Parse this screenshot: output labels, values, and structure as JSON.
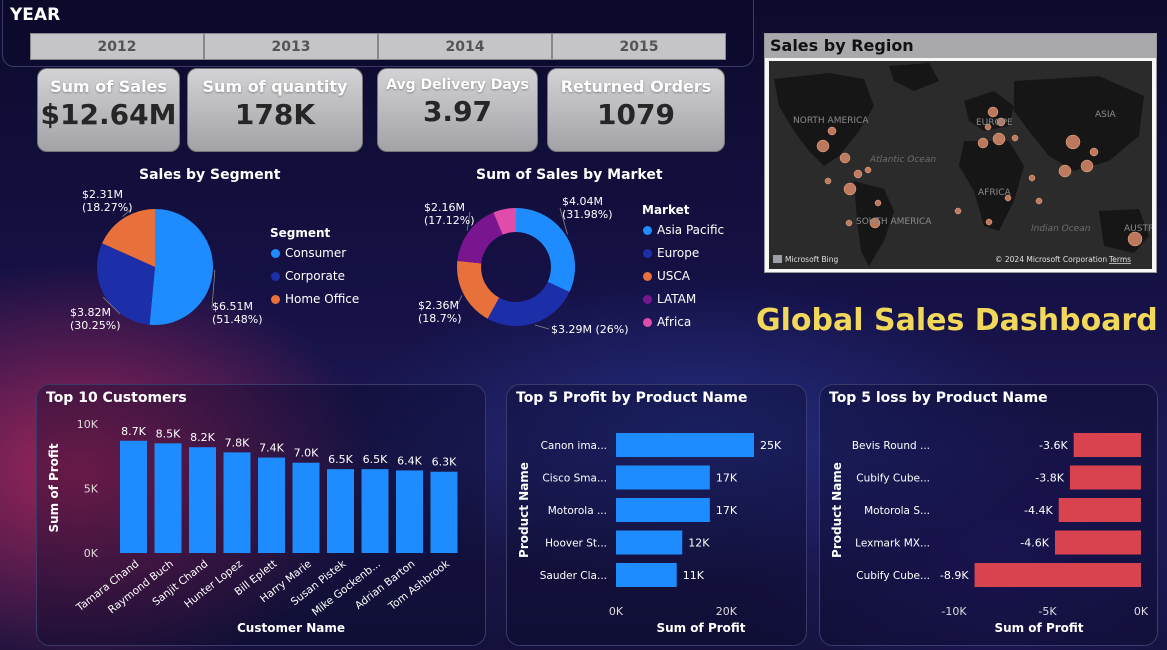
{
  "year": {
    "title": "YEAR",
    "buttons": [
      "2012",
      "2013",
      "2014",
      "2015"
    ]
  },
  "kpis": [
    {
      "label": "Sum of Sales",
      "value": "$12.64M"
    },
    {
      "label": "Sum of quantity",
      "value": "178K"
    },
    {
      "label": "Avg Delivery Days",
      "value": "3.97"
    },
    {
      "label": "Returned Orders",
      "value": "1079"
    }
  ],
  "dashboard_title": "Global Sales Dashboard",
  "map": {
    "title": "Sales by Region",
    "labels": {
      "north_america": "NORTH AMERICA",
      "europe": "EUROPE",
      "asia": "ASIA",
      "atlantic": "Atlantic Ocean",
      "africa": "AFRICA",
      "south_america": "SOUTH AMERICA",
      "indian": "Indian Ocean",
      "australia": "AUSTRA"
    },
    "brand": "Microsoft Bing",
    "copyright": "© 2024 Microsoft Corporation",
    "terms": "Terms"
  },
  "colors": {
    "blue": "#1e8cff",
    "navy": "#1d2fa8",
    "orange": "#e8703a",
    "purple": "#7a1590",
    "pink": "#e04caa",
    "red": "#d9434f",
    "title_yellow": "#f2d85a"
  },
  "chart_data": [
    {
      "id": "segment",
      "type": "pie",
      "title": "Sales by Segment",
      "legend_title": "Segment",
      "categories": [
        "Consumer",
        "Corporate",
        "Home Office"
      ],
      "values": [
        6.51,
        3.82,
        2.31
      ],
      "percent": [
        51.48,
        30.25,
        18.27
      ],
      "labels": [
        [
          "$6.51M",
          "(51.48%)"
        ],
        [
          "$3.82M",
          "(30.25%)"
        ],
        [
          "$2.31M",
          "(18.27%)"
        ]
      ],
      "colors": [
        "#1e8cff",
        "#1d2fa8",
        "#e8703a"
      ]
    },
    {
      "id": "market",
      "type": "pie",
      "subtype": "donut",
      "title": "Sum of Sales by Market",
      "legend_title": "Market",
      "categories": [
        "Asia Pacific",
        "Europe",
        "USCA",
        "LATAM",
        "Africa"
      ],
      "values": [
        4.04,
        3.29,
        2.36,
        2.16,
        0.79
      ],
      "percent": [
        31.98,
        26,
        18.7,
        17.12,
        6.2
      ],
      "labels": [
        [
          "$4.04M",
          "(31.98%)"
        ],
        [
          "$3.29M (26%)"
        ],
        [
          "$2.36M",
          "(18.7%)"
        ],
        [
          "$2.16M",
          "(17.12%)"
        ],
        []
      ],
      "colors": [
        "#1e8cff",
        "#1d2fa8",
        "#e8703a",
        "#7a1590",
        "#e04caa"
      ]
    },
    {
      "id": "customers",
      "type": "bar",
      "title": "Top 10 Customers",
      "xlabel": "Customer Name",
      "ylabel": "Sum of Profit",
      "categories": [
        "Tamara Chand",
        "Raymond Buch",
        "Sanjit Chand",
        "Hunter Lopez",
        "Bill Eplett",
        "Harry Marie",
        "Susan Pistek",
        "Mike Gockenb...",
        "Adrian Barton",
        "Tom Ashbrook"
      ],
      "values": [
        8.7,
        8.5,
        8.2,
        7.8,
        7.4,
        7.0,
        6.5,
        6.5,
        6.4,
        6.3
      ],
      "data_labels": [
        "8.7K",
        "8.5K",
        "8.2K",
        "7.8K",
        "7.4K",
        "7.0K",
        "6.5K",
        "6.5K",
        "6.4K",
        "6.3K"
      ],
      "yticks": [
        "0K",
        "5K",
        "10K"
      ],
      "ylim": [
        0,
        10
      ],
      "color": "#1e8cff"
    },
    {
      "id": "profit",
      "type": "bar",
      "orientation": "horizontal",
      "title": "Top 5 Profit by Product Name",
      "xlabel": "Sum of Profit",
      "ylabel": "Product Name",
      "categories": [
        "Canon ima...",
        "Cisco Sma...",
        "Motorola ...",
        "Hoover St...",
        "Sauder Cla..."
      ],
      "values": [
        25,
        17,
        17,
        12,
        11
      ],
      "data_labels": [
        "25K",
        "17K",
        "17K",
        "12K",
        "11K"
      ],
      "xticks": [
        "0K",
        "20K"
      ],
      "xlim": [
        0,
        25
      ],
      "color": "#1e8cff"
    },
    {
      "id": "loss",
      "type": "bar",
      "orientation": "horizontal",
      "title": "Top 5 loss by Product Name",
      "xlabel": "Sum of Profit",
      "ylabel": "Product Name",
      "categories": [
        "Bevis Round ...",
        "Cubify Cube...",
        "Motorola S...",
        "Lexmark MX...",
        "Cubify Cube..."
      ],
      "values": [
        -3.6,
        -3.8,
        -4.4,
        -4.6,
        -8.9
      ],
      "data_labels": [
        "-3.6K",
        "-3.8K",
        "-4.4K",
        "-4.6K",
        "-8.9K"
      ],
      "xticks": [
        "-10K",
        "-5K",
        "0K"
      ],
      "xlim": [
        -10,
        0
      ],
      "color": "#d9434f"
    }
  ]
}
